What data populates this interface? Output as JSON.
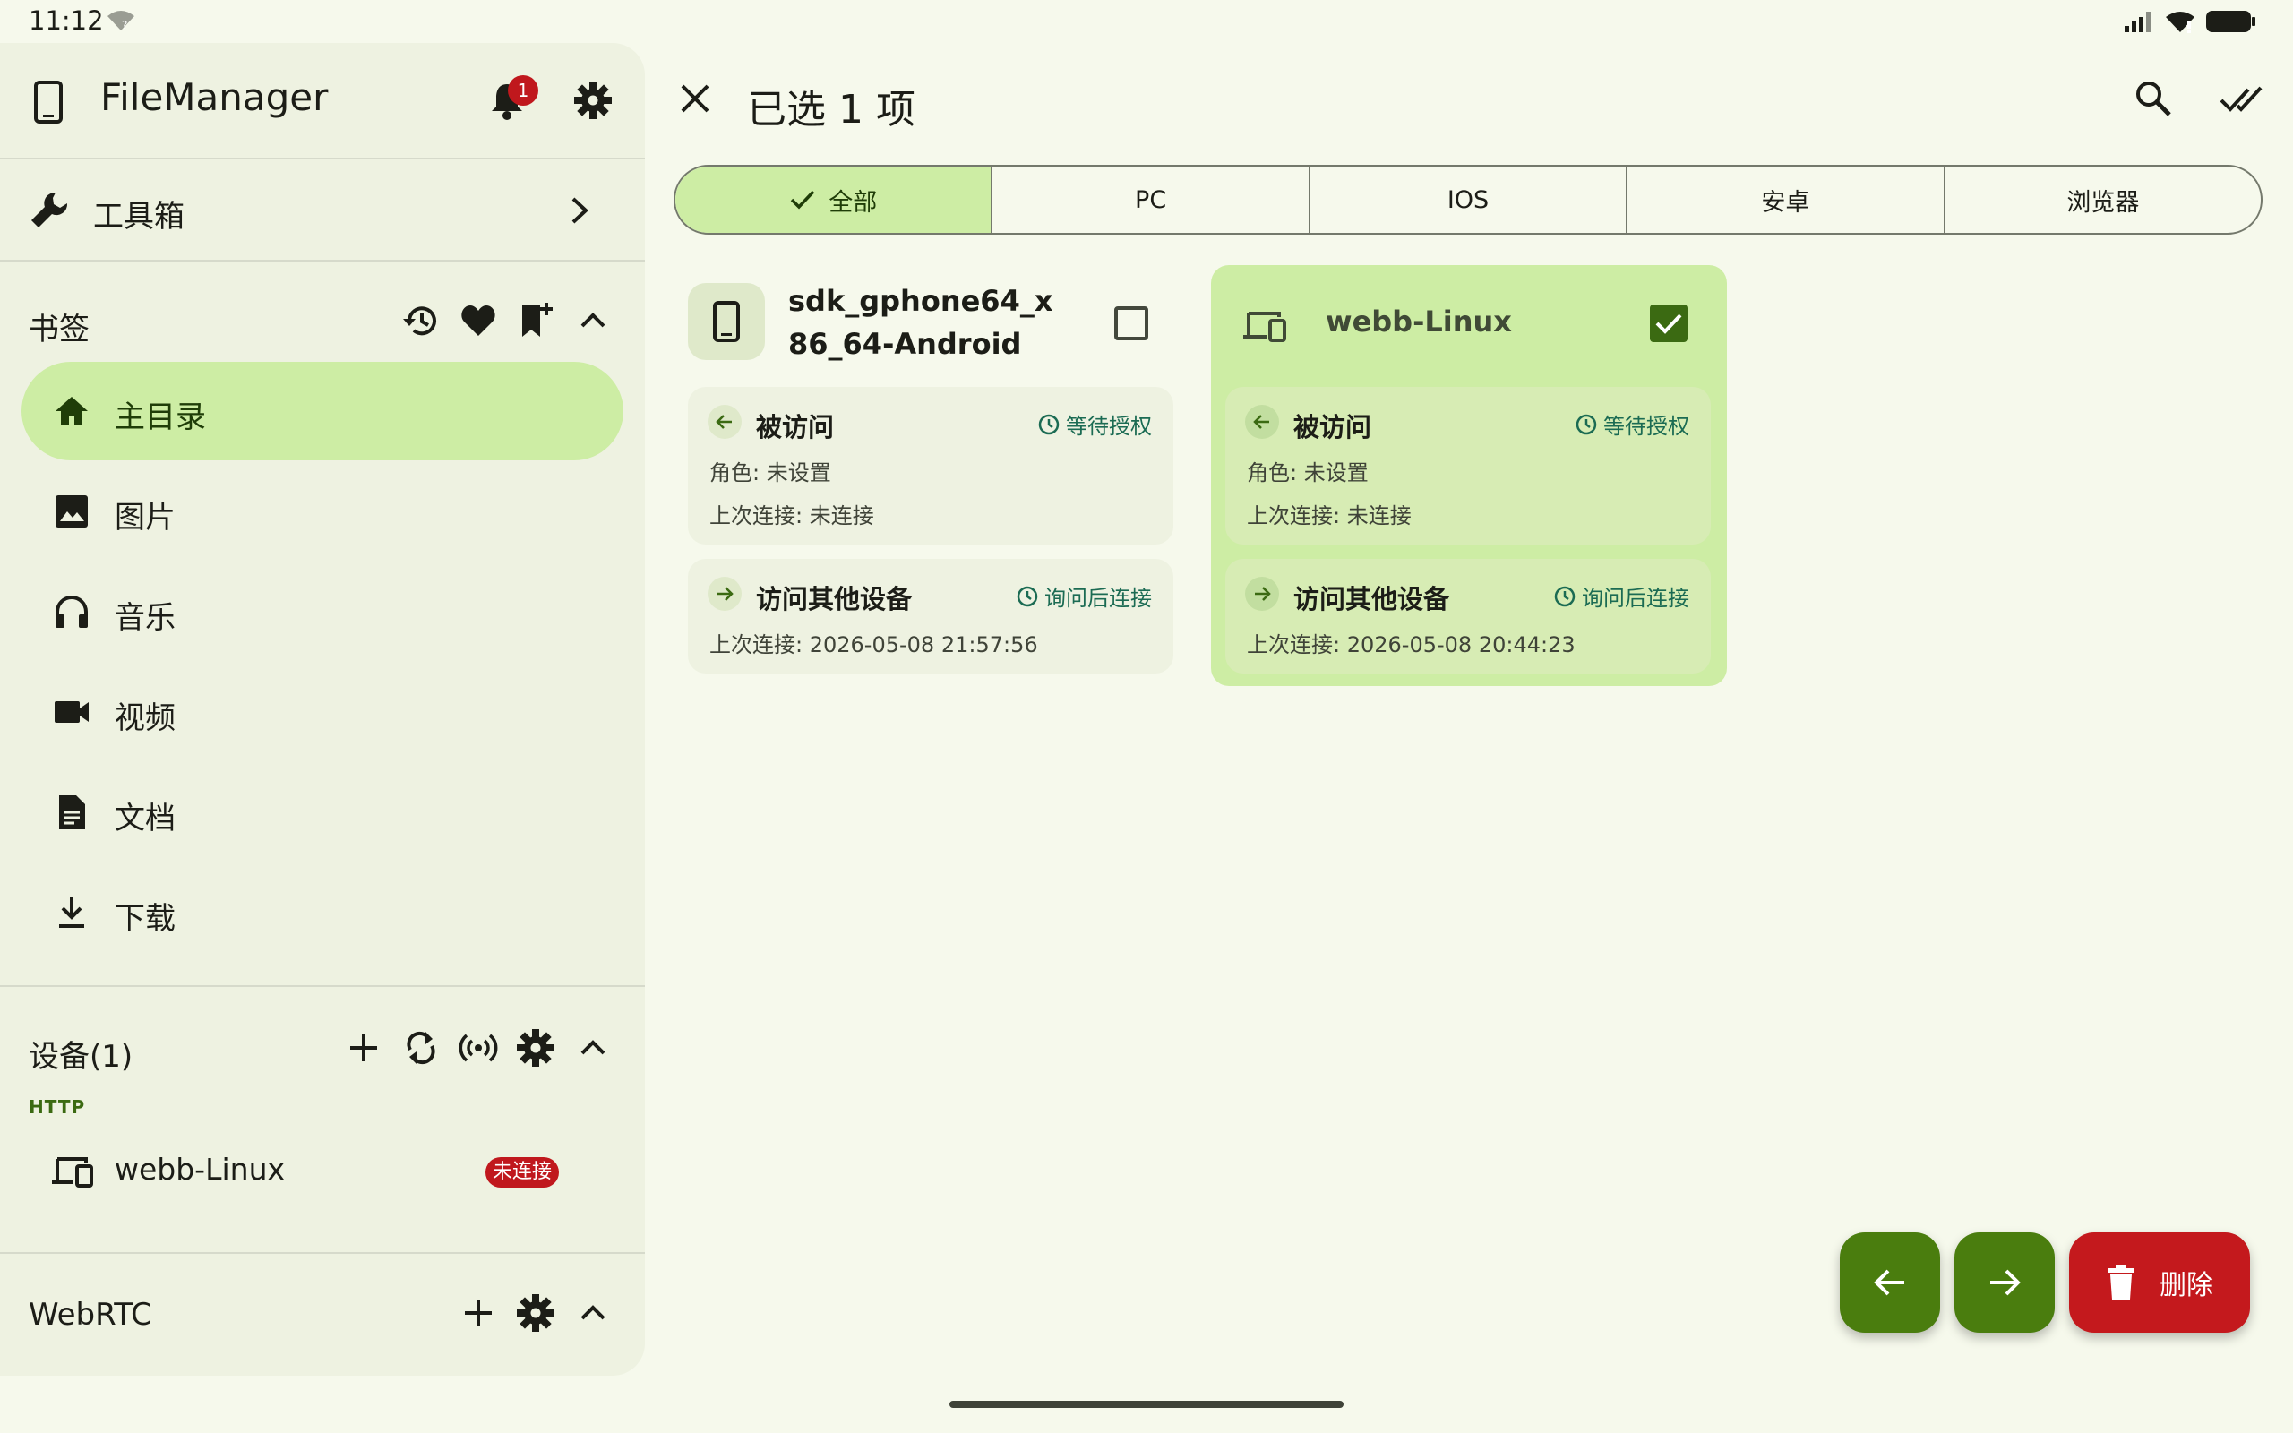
{
  "status_bar": {
    "time": "11:12"
  },
  "sidebar": {
    "app_title": "FileManager",
    "notification_count": "1",
    "toolbox_label": "工具箱",
    "bookmarks_title": "书签",
    "nav_items": [
      {
        "label": "主目录",
        "icon": "home-icon",
        "active": true
      },
      {
        "label": "图片",
        "icon": "image-icon"
      },
      {
        "label": "音乐",
        "icon": "headphones-icon"
      },
      {
        "label": "视频",
        "icon": "videocam-icon"
      },
      {
        "label": "文档",
        "icon": "document-icon"
      },
      {
        "label": "下载",
        "icon": "download-icon"
      }
    ],
    "devices_title": "设备(1)",
    "http_label": "HTTP",
    "device": {
      "name": "webb-Linux",
      "status": "未连接"
    },
    "webrtc_title": "WebRTC"
  },
  "main": {
    "title": "已选 1 项",
    "tabs": [
      {
        "label": "全部",
        "active": true
      },
      {
        "label": "PC"
      },
      {
        "label": "IOS"
      },
      {
        "label": "安卓"
      },
      {
        "label": "浏览器"
      }
    ],
    "cards": [
      {
        "title": "sdk_gphone64_x86_64-Android",
        "selected": false,
        "incoming": {
          "title": "被访问",
          "status": "等待授权",
          "role": "角色: 未设置",
          "last": "上次连接: 未连接"
        },
        "outgoing": {
          "title": "访问其他设备",
          "status": "询问后连接",
          "last": "上次连接: 2026-05-08 21:57:56"
        }
      },
      {
        "title": "webb-Linux",
        "selected": true,
        "incoming": {
          "title": "被访问",
          "status": "等待授权",
          "role": "角色: 未设置",
          "last": "上次连接: 未连接"
        },
        "outgoing": {
          "title": "访问其他设备",
          "status": "询问后连接",
          "last": "上次连接: 2026-05-08 20:44:23"
        }
      }
    ],
    "delete_label": "删除"
  },
  "colors": {
    "accent_container": "#cdeda4",
    "primary": "#3b6a12",
    "error": "#c4191d",
    "status_teal": "#1b6b53"
  }
}
